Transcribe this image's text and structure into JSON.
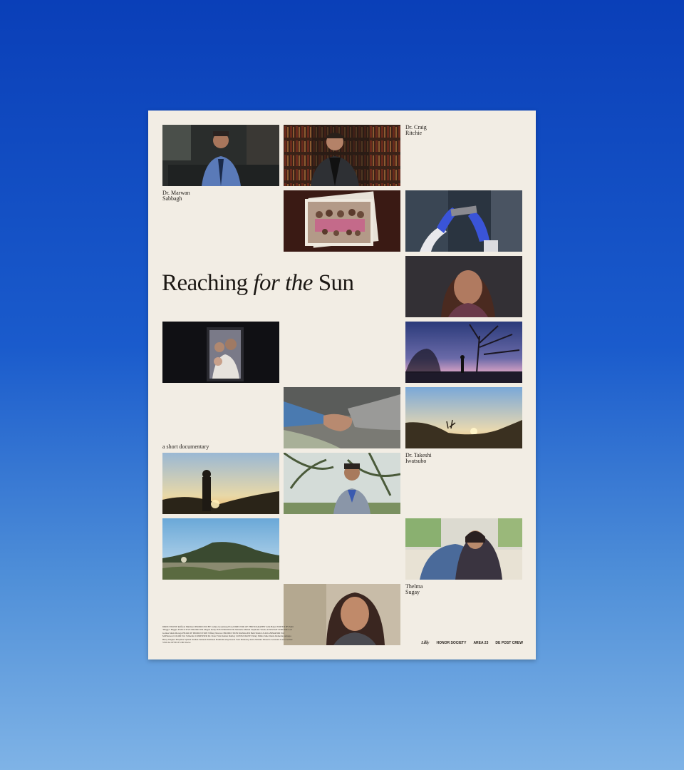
{
  "poster": {
    "title_part1": "Reaching ",
    "title_italic": "for the",
    "title_part2": " Sun",
    "subtitle": "a short documentary",
    "labels": {
      "marwan": [
        "Dr. Marwan",
        "Sabbagh"
      ],
      "craig": [
        "Dr. Craig",
        "Ritchie"
      ],
      "takeshi": [
        "Dr. Takeshi",
        "Iwatsubo"
      ],
      "thelma": [
        "Thelma",
        "Sugay"
      ]
    },
    "credits": "DIRECTED BY Rafferal Mirnhard PRODUCED BY Joshua Greenberg PGA DIRECTOR OF PHOTOGRAPHY John Baker EDITED BY Matt \"Bugga\" Baggio EXECUTIVE PRODUCER Megan Kelly POST PRODUCER Michelle Mehall Stephanie Wrede ASSISTANT EDITOR Carl Gomes Mark Moraga HEAD OF PRODUCTION Tiffany Morrow PRODUCTION MANAGER Beth Shults LEAD ANIMATOR Eric McPherson COLOR Eric Schneller COMPOSER Dr. Peter Fritz Roman Dudley CONSULTANTS Mary Miller Julie Danlo Demetrio Ariaspa Betsy Wagner Maryline Sprinel Nathan Samuels Kathleen Hamblin Amy Kueck Tom Mahoney Anita Mitsike Eduardo Gonzalez Laura Gomez VISUAL EFFECTS Mi Waeve",
    "logos": [
      "Lilly",
      "HONOR SOCIETY",
      "AREA 23",
      "DE POST CREW"
    ]
  },
  "colors": {
    "page_background_top": "#0a3fb8",
    "page_background_bottom": "#7fb3e6",
    "poster_paper": "#f2ede4",
    "ink": "#1c1814"
  }
}
